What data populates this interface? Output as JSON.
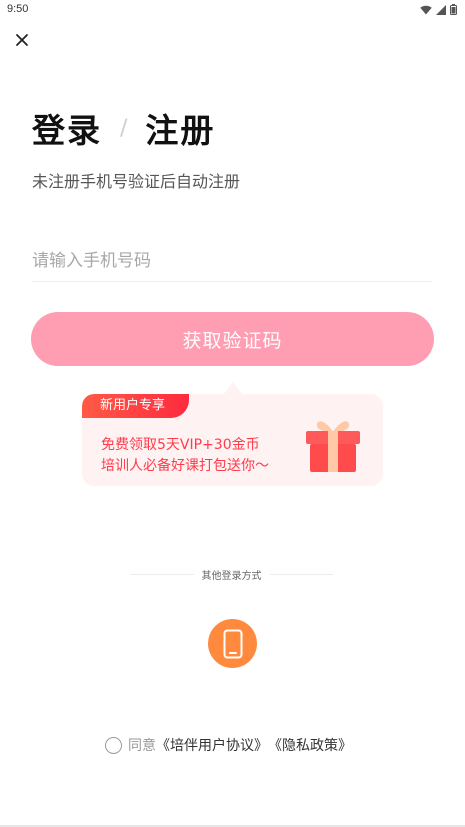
{
  "status_bar": {
    "time": "9:50",
    "icons": [
      "wifi-icon",
      "signal-icon",
      "battery-icon"
    ]
  },
  "header": {
    "close_icon": "close-icon"
  },
  "title": {
    "login": "登录",
    "separator": "/",
    "register": "注册"
  },
  "subtitle": "未注册手机号验证后自动注册",
  "phone_input": {
    "value": "",
    "placeholder": "请输入手机号码"
  },
  "get_code_button": {
    "label": "获取验证码",
    "color": "#ff9db2"
  },
  "promo": {
    "badge": "新用户专享",
    "line1": "免费领取5天VIP+30金币",
    "line2": "培训人必备好课打包送你～",
    "icon": "gift-icon",
    "accent_color": "#ff3b4a",
    "background": "#fff2f3"
  },
  "other_login": {
    "label": "其他登录方式",
    "methods": [
      {
        "name": "phone",
        "icon": "phone-icon",
        "color": "#ff8a3d"
      }
    ]
  },
  "agreement": {
    "prefix": "同意",
    "user_agreement": "《培伴用户协议》",
    "privacy_policy": "《隐私政策》",
    "checked": false
  }
}
